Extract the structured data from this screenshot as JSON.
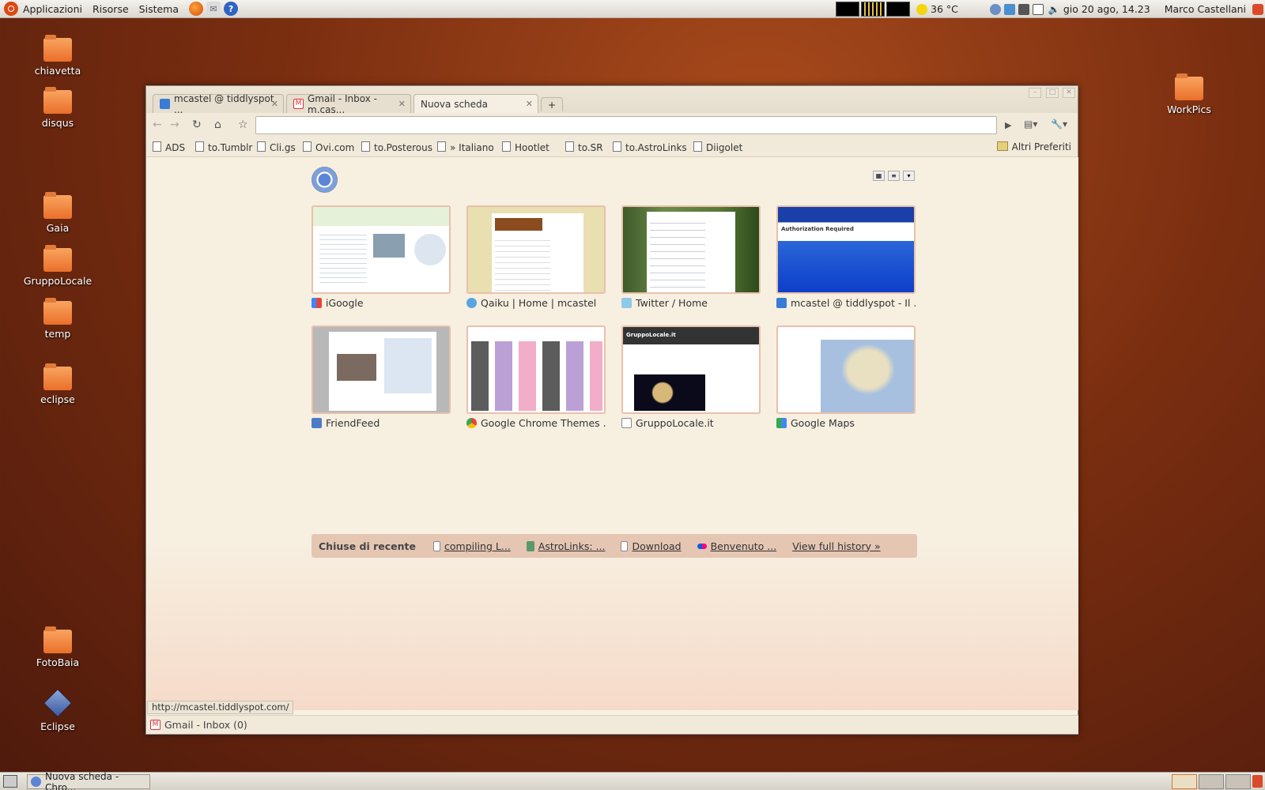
{
  "top_panel": {
    "menus": [
      "Applicazioni",
      "Risorse",
      "Sistema"
    ],
    "temperature": "36 °C",
    "datetime": "gio 20 ago, 14.23",
    "user": "Marco Castellani"
  },
  "desktop_icons": [
    "chiavetta",
    "disqus",
    "Gaia",
    "GruppoLocale",
    "temp",
    "eclipse",
    "FotoBaia",
    "Eclipse",
    "WorkPics"
  ],
  "browser": {
    "tabs": [
      "mcastel @ tiddlyspot ...",
      "Gmail - Inbox - m.cas...",
      "Nuova scheda"
    ],
    "bookmarks": [
      "ADS",
      "to.Tumblr",
      "Cli.gs",
      "Ovi.com",
      "to.Posterous",
      "» Italiano",
      "Hootlet",
      "to.SR",
      "to.AstroLinks",
      "Diigolet"
    ],
    "other_bookmarks": "Altri Preferiti",
    "thumbnails": [
      "iGoogle",
      "Qaiku | Home | mcastel",
      "Twitter / Home",
      "mcastel @ tiddlyspot - Il ...",
      "FriendFeed",
      "Google Chrome Themes ...",
      "GruppoLocale.it",
      "Google Maps"
    ],
    "thumb_texts": {
      "auth": "Authorization Required",
      "gruppo": "GruppoLocale.it"
    },
    "recent": {
      "title": "Chiuse di recente",
      "items": [
        "compiling L...",
        "AstroLinks: ...",
        "Download",
        "Benvenuto ..."
      ],
      "history": "View full history »"
    },
    "status_url": "http://mcastel.tiddlyspot.com/",
    "download_item": "Gmail - Inbox (0)"
  },
  "taskbar": {
    "window": "Nuova scheda - Chro..."
  }
}
